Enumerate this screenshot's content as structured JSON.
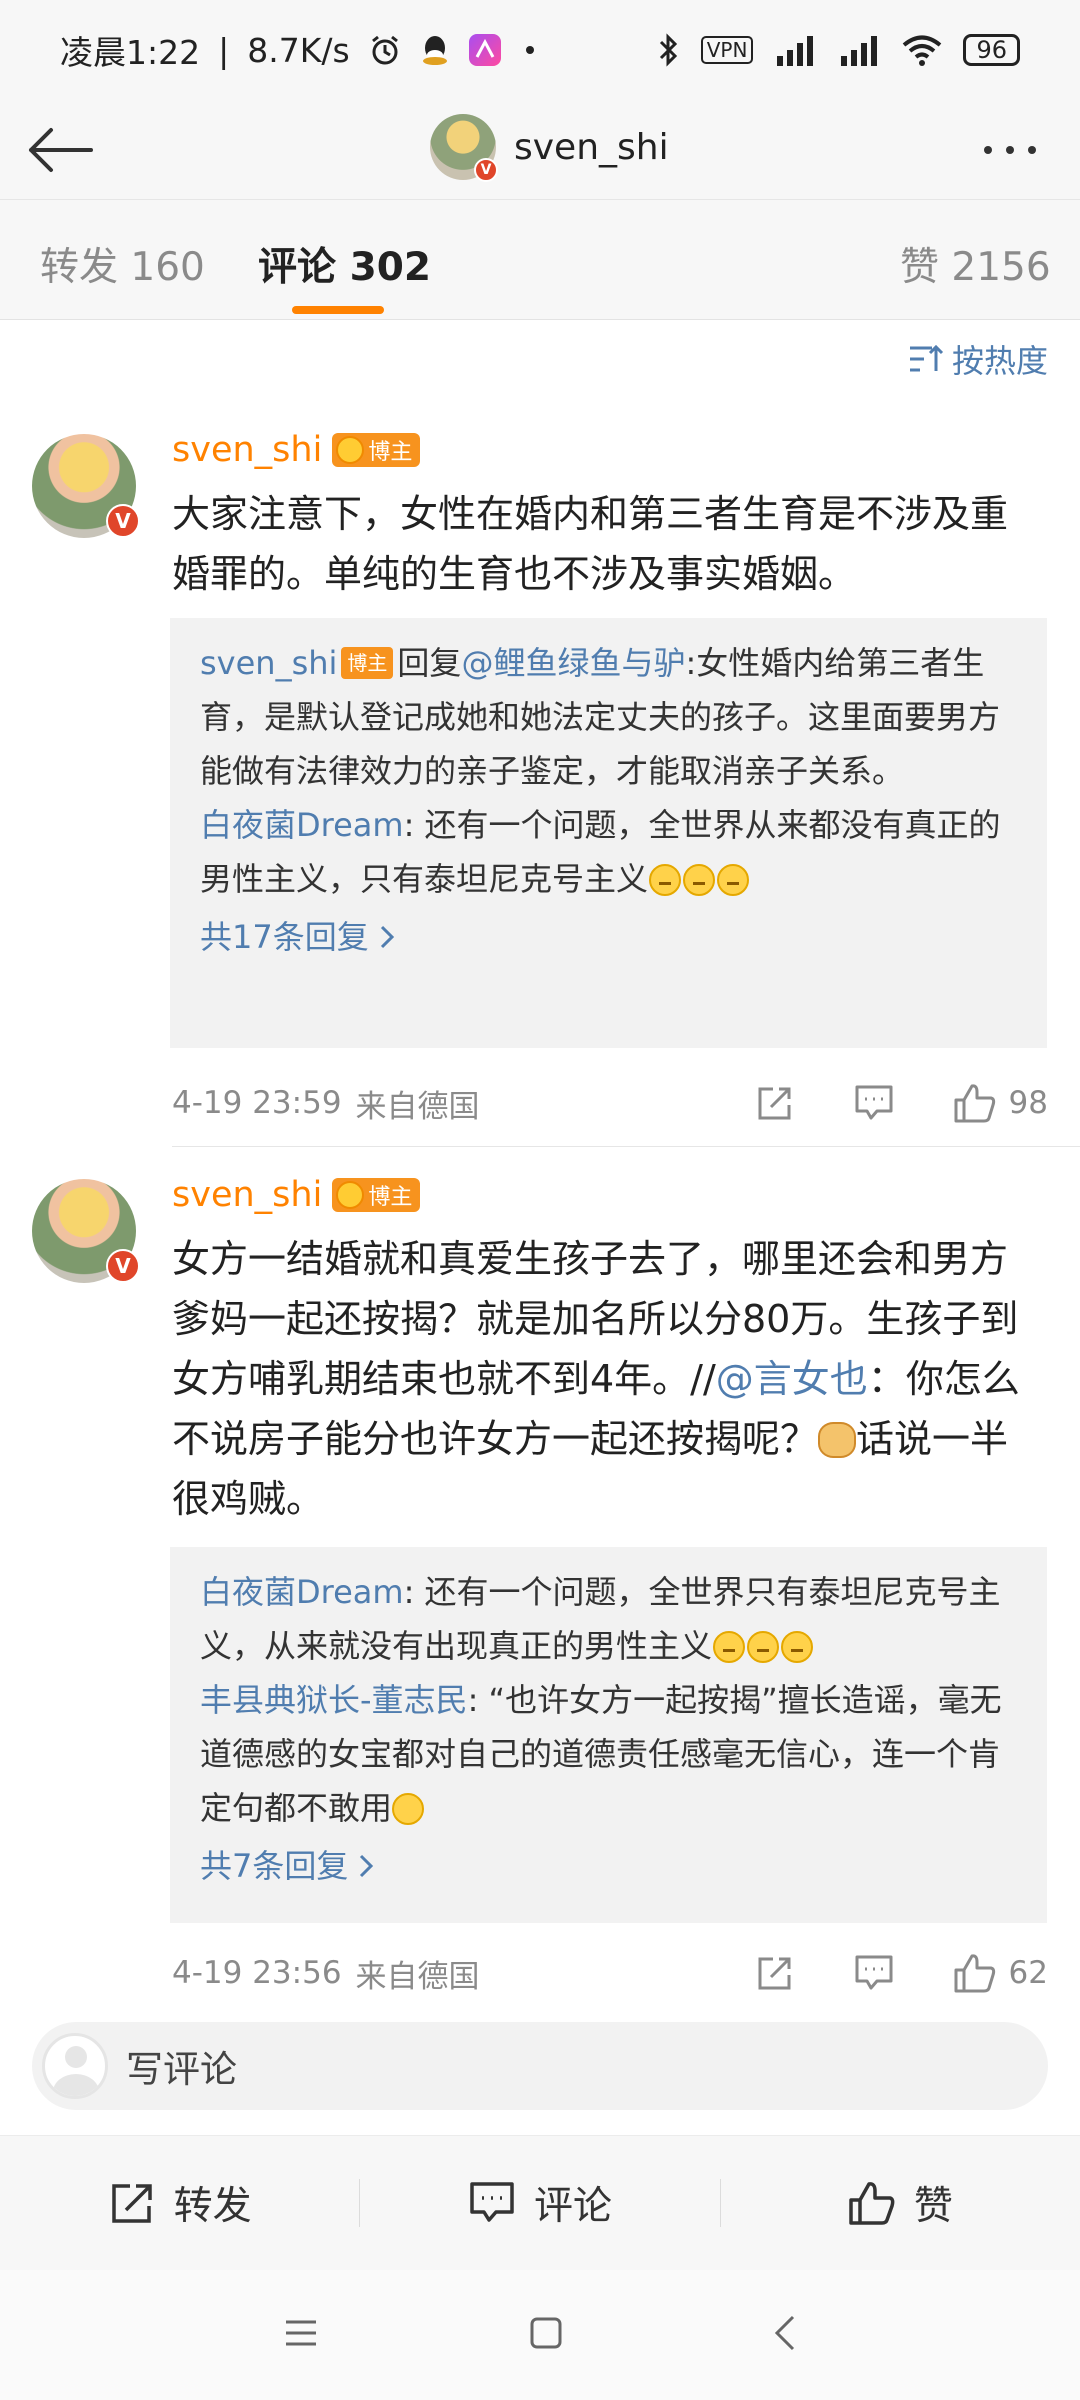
{
  "status_bar": {
    "time": "凌晨1:22",
    "speed": "8.7K/s",
    "vpn": "VPN",
    "battery": "96"
  },
  "header": {
    "title": "sven_shi"
  },
  "tabs": [
    {
      "label": "转发",
      "count": "160"
    },
    {
      "label": "评论",
      "count": "302"
    },
    {
      "label": "赞",
      "count": "2156"
    }
  ],
  "sort": {
    "label": "按热度"
  },
  "comments": [
    {
      "author": "sven_shi",
      "badge": "博主",
      "text": "大家注意下，女性在婚内和第三者生育是不涉及重婚罪的。单纯的生育也不涉及事实婚姻。",
      "replies": [
        {
          "name": "sven_shi",
          "badge": "博主",
          "reply_word": "回复",
          "mention": "@鲤鱼绿鱼与驴",
          "text": ":女性婚内给第三者生育，是默认登记成她和她法定丈夫的孩子。这里面要男方能做有法律效力的亲子鉴定，才能取消亲子关系。"
        },
        {
          "name": "白夜菌Dream",
          "text": ": 还有一个问题，全世界从来都没有真正的男性主义，只有泰坦尼克号主义"
        }
      ],
      "more_replies": "共17条回复",
      "time": "4-19 23:59",
      "source": "来自德国",
      "likes": "98"
    },
    {
      "author": "sven_shi",
      "badge": "博主",
      "text_before": "女方一结婚就和真爱生孩子去了，哪里还会和男方爹妈一起还按揭？就是加名所以分80万。生孩子到女方哺乳期结束也就不到4年。//",
      "mention": "@言女也",
      "text_after": "：你怎么不说房子能分也许女方一起还按揭呢？",
      "text_tail": "话说一半很鸡贼。",
      "replies": [
        {
          "name": "白夜菌Dream",
          "text": ": 还有一个问题，全世界只有泰坦尼克号主义，从来就没有出现真正的男性主义"
        },
        {
          "name": "丰县典狱长-董志民",
          "text": ": “也许女方一起按揭”擅长造谣，毫无道德感的女宝都对自己的道德责任感毫无信心，连一个肯定句都不敢用"
        }
      ],
      "more_replies": "共7条回复",
      "time": "4-19 23:56",
      "source": "来自德国",
      "likes": "62"
    }
  ],
  "input": {
    "placeholder": "写评论"
  },
  "bottom_bar": {
    "repost": "转发",
    "comment": "评论",
    "like": "赞"
  },
  "colors": {
    "accent": "#ff8200",
    "link": "#507daf",
    "vip_badge": "#e0462a"
  }
}
